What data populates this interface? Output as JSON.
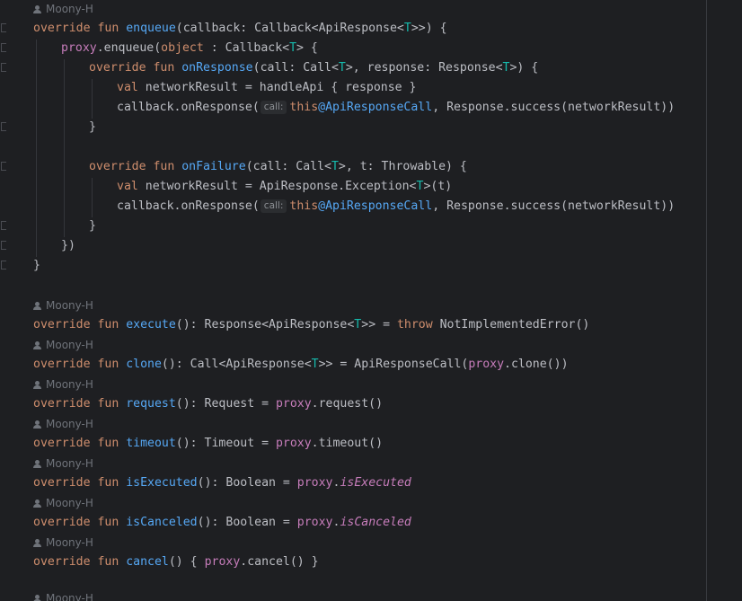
{
  "author": "Moony-H",
  "hint_label": "call:",
  "lines": {
    "l1": {
      "kw1": "override fun ",
      "fn": "enqueue",
      "rest": "(callback: Callback<ApiResponse<",
      "tp": "T",
      "end": ">>) {"
    },
    "l2": {
      "prop": "proxy",
      "a": ".enqueue(",
      "kw": "object",
      "b": " : Callback<",
      "tp": "T",
      "c": "> {"
    },
    "l3": {
      "kw": "override fun ",
      "fn": "onResponse",
      "a": "(call: Call<",
      "tp1": "T",
      "b": ">, response: Response<",
      "tp2": "T",
      "c": ">) {"
    },
    "l4": {
      "kw": "val",
      "a": " networkResult = handleApi { response }"
    },
    "l5": {
      "a": "callback.onResponse(",
      "kw": "this",
      "lbl": "@ApiResponseCall",
      "b": ", Response.success(networkResult))"
    },
    "l6": {
      "a": "}"
    },
    "l7": {
      "kw": "override fun ",
      "fn": "onFailure",
      "a": "(call: Call<",
      "tp": "T",
      "b": ">, t: Throwable) {"
    },
    "l8": {
      "kw": "val",
      "a": " networkResult = ApiResponse.Exception<",
      "tp": "T",
      "b": ">(t)"
    },
    "l9": {
      "a": "callback.onResponse(",
      "kw": "this",
      "lbl": "@ApiResponseCall",
      "b": ", Response.success(networkResult))"
    },
    "l10": {
      "a": "}"
    },
    "l11": {
      "a": "})"
    },
    "l12": {
      "a": "}"
    },
    "m1": {
      "kw": "override fun ",
      "fn": "execute",
      "a": "(): Response<ApiResponse<",
      "tp": "T",
      "b": ">> = ",
      "kw2": "throw",
      "c": " NotImplementedError()"
    },
    "m2": {
      "kw": "override fun ",
      "fn": "clone",
      "a": "(): Call<ApiResponse<",
      "tp": "T",
      "b": ">> = ApiResponseCall(",
      "prop": "proxy",
      "c": ".clone())"
    },
    "m3": {
      "kw": "override fun ",
      "fn": "request",
      "a": "(): Request = ",
      "prop": "proxy",
      "b": ".request()"
    },
    "m4": {
      "kw": "override fun ",
      "fn": "timeout",
      "a": "(): Timeout = ",
      "prop": "proxy",
      "b": ".timeout()"
    },
    "m5": {
      "kw": "override fun ",
      "fn": "isExecuted",
      "a": "(): Boolean = ",
      "prop": "proxy",
      "b": ".",
      "ital": "isExecuted"
    },
    "m6": {
      "kw": "override fun ",
      "fn": "isCanceled",
      "a": "(): Boolean = ",
      "prop": "proxy",
      "b": ".",
      "ital": "isCanceled"
    },
    "m7": {
      "kw": "override fun ",
      "fn": "cancel",
      "a": "() { ",
      "prop": "proxy",
      "b": ".cancel() }"
    }
  }
}
